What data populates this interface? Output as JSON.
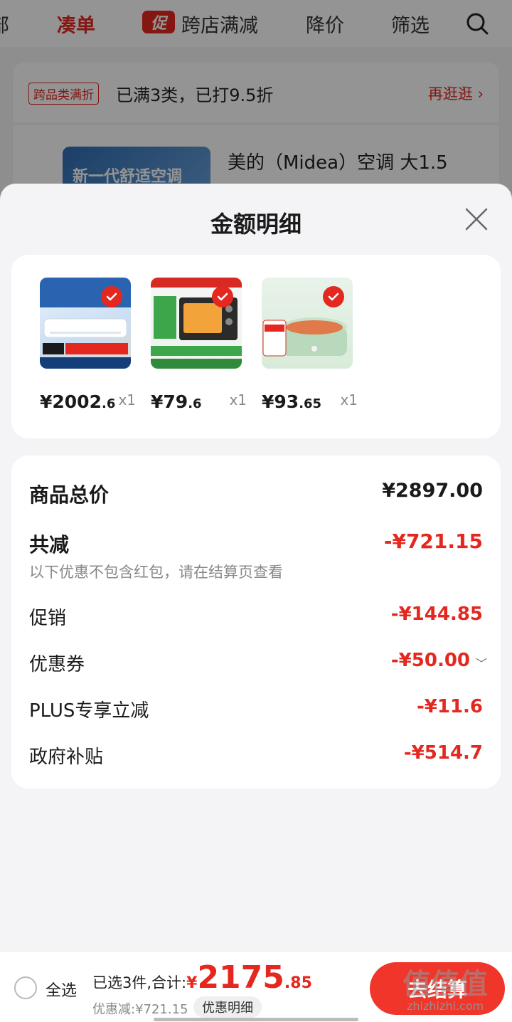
{
  "colors": {
    "accent": "#e4281f",
    "checkout": "#f0352a"
  },
  "background": {
    "nav": {
      "partial_tab": "部",
      "active_tab": "凑单",
      "promo_badge": "促",
      "cross_store_tab": "跨店满减",
      "price_drop_tab": "降价",
      "filter_tab": "筛选",
      "search_icon": "search-icon"
    },
    "promo": {
      "tag": "跨品类满折",
      "text": "已满3类，已打9.5折",
      "more": "再逛逛 ›"
    },
    "product": {
      "image_text": "新一代舒适空调",
      "title": "美的（Midea）空调 大1.5"
    }
  },
  "sheet": {
    "title": "金额明细",
    "close_icon": "close-icon",
    "products": [
      {
        "image_label": "空调",
        "price_int": "¥2002",
        "price_dec": ".6",
        "qty": "x1"
      },
      {
        "image_label": "电烤箱",
        "price_int": "¥79",
        "price_dec": ".6",
        "qty": "x1"
      },
      {
        "image_label": "电煮锅",
        "price_int": "¥93",
        "price_dec": ".65",
        "qty": "x1"
      }
    ],
    "summary": {
      "total_label": "商品总价",
      "total_value": "¥2897.00",
      "reduce_label": "共减",
      "reduce_value": "-¥721.15",
      "reduce_note": "以下优惠不包含红包，请在结算页查看",
      "items": [
        {
          "label": "促销",
          "value": "-¥144.85"
        },
        {
          "label": "优惠券",
          "value": "-¥50.00"
        },
        {
          "label": "PLUS专享立减",
          "value": "-¥11.6"
        },
        {
          "label": "政府补贴",
          "value": "-¥514.7"
        }
      ]
    }
  },
  "bottom_bar": {
    "select_all": "全选",
    "selected_text": "已选3件,合计:",
    "yen": "¥",
    "total_int": "2175",
    "total_dec": ".85",
    "discount_text": "优惠减:¥721.15",
    "detail_button": "优惠明细",
    "checkout_button": "去结算"
  },
  "watermark": {
    "text": "值值值",
    "url": "zhizhizhi.com"
  }
}
